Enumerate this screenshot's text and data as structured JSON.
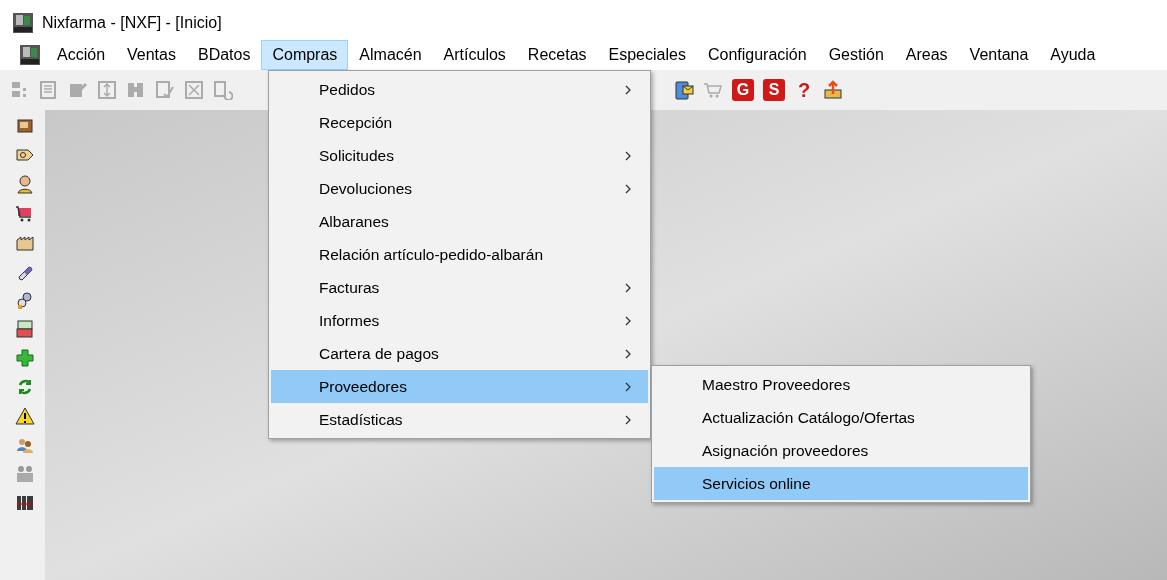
{
  "window": {
    "title": "Nixfarma - [NXF] - [Inicio]"
  },
  "menu_bar": [
    {
      "label": "Acción",
      "selected": false
    },
    {
      "label": "Ventas",
      "selected": false
    },
    {
      "label": "BDatos",
      "selected": false
    },
    {
      "label": "Compras",
      "selected": true
    },
    {
      "label": "Almacén",
      "selected": false
    },
    {
      "label": "Artículos",
      "selected": false
    },
    {
      "label": "Recetas",
      "selected": false
    },
    {
      "label": "Especiales",
      "selected": false
    },
    {
      "label": "Configuración",
      "selected": false
    },
    {
      "label": "Gestión",
      "selected": false
    },
    {
      "label": "Areas",
      "selected": false
    },
    {
      "label": "Ventana",
      "selected": false
    },
    {
      "label": "Ayuda",
      "selected": false
    }
  ],
  "toolbar": [
    {
      "kind": "icon",
      "disabled": true
    },
    {
      "kind": "icon",
      "disabled": true
    },
    {
      "kind": "icon",
      "disabled": true
    },
    {
      "kind": "icon",
      "disabled": true
    },
    {
      "kind": "icon",
      "disabled": true
    },
    {
      "kind": "icon",
      "disabled": true
    },
    {
      "kind": "icon",
      "disabled": true
    },
    {
      "kind": "icon",
      "disabled": true
    },
    {
      "kind": "icon",
      "disabled": false
    },
    {
      "kind": "icon",
      "disabled": true
    },
    {
      "kind": "letter",
      "label": "G",
      "disabled": false
    },
    {
      "kind": "letter",
      "label": "S",
      "disabled": false
    },
    {
      "kind": "glyph",
      "label": "?",
      "disabled": false
    },
    {
      "kind": "icon",
      "disabled": false
    }
  ],
  "compras_menu": [
    {
      "label": "Pedidos",
      "has_submenu": true,
      "selected": false
    },
    {
      "label": "Recepción",
      "has_submenu": false,
      "selected": false
    },
    {
      "label": "Solicitudes",
      "has_submenu": true,
      "selected": false
    },
    {
      "label": "Devoluciones",
      "has_submenu": true,
      "selected": false
    },
    {
      "label": "Albaranes",
      "has_submenu": false,
      "selected": false
    },
    {
      "label": "Relación artículo-pedido-albarán",
      "has_submenu": false,
      "selected": false
    },
    {
      "label": "Facturas",
      "has_submenu": true,
      "selected": false
    },
    {
      "label": "Informes",
      "has_submenu": true,
      "selected": false
    },
    {
      "label": "Cartera de pagos",
      "has_submenu": true,
      "selected": false
    },
    {
      "label": "Proveedores",
      "has_submenu": true,
      "selected": true
    },
    {
      "label": "Estadísticas",
      "has_submenu": true,
      "selected": false
    }
  ],
  "proveedores_submenu": [
    {
      "label": "Maestro Proveedores",
      "selected": false
    },
    {
      "label": "Actualización Catálogo/Ofertas",
      "selected": false
    },
    {
      "label": "Asignación proveedores",
      "selected": false
    },
    {
      "label": "Servicios online",
      "selected": true
    }
  ]
}
